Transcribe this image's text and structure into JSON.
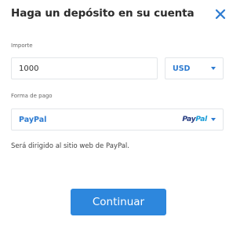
{
  "dialog": {
    "title": "Haga un depósito en su cuenta",
    "close_icon": "close-icon"
  },
  "amount": {
    "label": "Importe",
    "value": "1000"
  },
  "currency": {
    "selected": "USD",
    "dropdown_icon": "chevron-down-icon"
  },
  "payment_method": {
    "label": "Forma de pago",
    "selected": "PayPal",
    "logo_text_pay": "Pay",
    "logo_text_pal": "Pal",
    "dropdown_icon": "chevron-down-icon"
  },
  "redirect_note": "Será dirigido al sitio web de PayPal.",
  "actions": {
    "continue_label": "Continuar"
  },
  "colors": {
    "accent": "#2d87dd",
    "link_blue": "#2d7bd1",
    "paypal_dark": "#253b80",
    "paypal_light": "#179bd7"
  }
}
